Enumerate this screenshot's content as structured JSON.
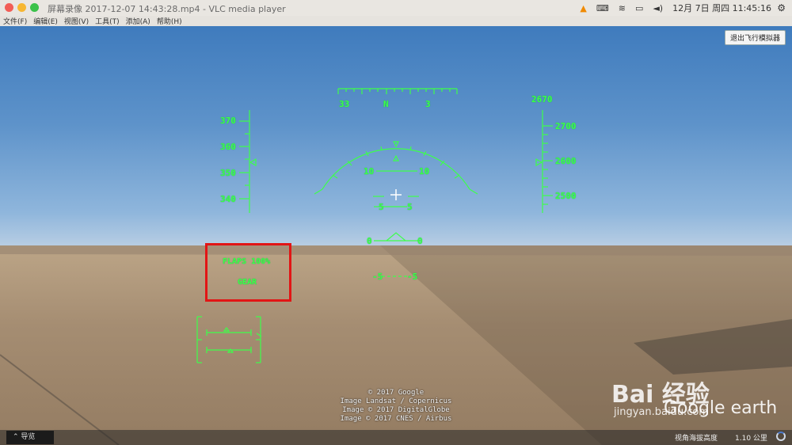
{
  "window": {
    "title": "屏幕录像 2017-12-07 14:43:28.mp4 - VLC media player"
  },
  "system": {
    "datetime": "12月 7日 周四 11:45:16"
  },
  "menubar": {
    "items": [
      "文件(F)",
      "编辑(E)",
      "视图(V)",
      "工具(T)",
      "添加(A)",
      "帮助(H)"
    ]
  },
  "toolbar": {
    "exit_label": "退出飞行模拟器"
  },
  "hud": {
    "heading_labels": [
      "33",
      "N",
      "3"
    ],
    "speed_ticks": [
      "370",
      "360",
      "350",
      "340"
    ],
    "altitude_top": "2670",
    "altitude_ticks": [
      "2700",
      "2600",
      "2500"
    ],
    "pitch_10_left": "10",
    "pitch_10_right": "10",
    "pitch_5_left": "5",
    "pitch_5_right": "5",
    "pitch_0_left": "0",
    "pitch_0_right": "0",
    "pitch_m5_left": "-5",
    "pitch_m5_right": "-5",
    "flaps": "FLAPS  100%",
    "gear": "GEAR"
  },
  "copyright": [
    "© 2017 Google",
    "Image Landsat / Copernicus",
    "Image © 2017 DigitalGlobe",
    "Image © 2017 CNES / Airbus"
  ],
  "statusbar": {
    "nav_label": "导览",
    "altitude_label": "视角海拔高度",
    "altitude_value": "1.10 公里"
  },
  "watermark": {
    "brand": "Bai 经验",
    "site": "jingyan.baidu.com",
    "product": "Google earth"
  },
  "colors": {
    "hud": "#3dff4a",
    "highlight": "#e21515"
  }
}
